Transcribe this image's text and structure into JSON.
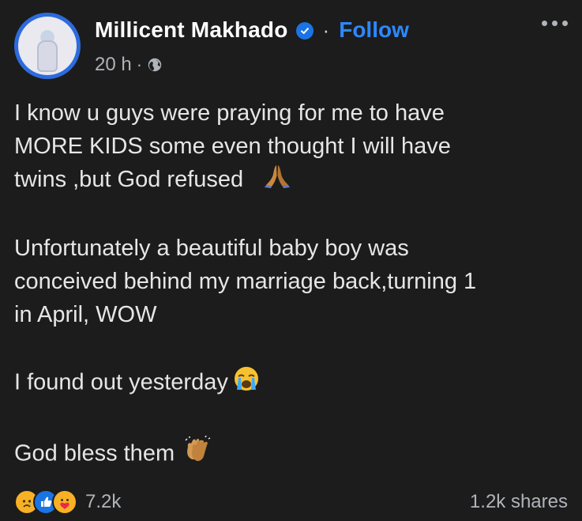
{
  "post": {
    "author": "Millicent Makhado",
    "follow_label": "Follow",
    "separator": "·",
    "time": "20 h",
    "lines_p1": [
      "I know u guys were praying for me to have",
      "MORE KIDS  some even thought I will have",
      "twins ,but God refused"
    ],
    "lines_p2": [
      "Unfortunately a beautiful baby boy was",
      "conceived behind my marriage back,turning 1",
      "in April, WOW"
    ],
    "line_p3": "I found out yesterday",
    "line_p4": "God bless them",
    "reaction_count": "7.2k",
    "shares": "1.2k shares"
  },
  "icons": {
    "avatar": "profile-photo",
    "verified": "verified-badge-icon",
    "globe": "globe-icon",
    "more": "more-options-icon",
    "emoji_p1": "praying-hands-emoji",
    "emoji_p3": "crying-face-emoji",
    "emoji_p4": "clapping-hands-emoji",
    "reactions": [
      "sad-reaction-icon",
      "like-reaction-icon",
      "care-reaction-icon"
    ]
  },
  "colors": {
    "background": "#1c1c1c",
    "follow": "#2d88ff",
    "verified": "#1b74e4",
    "muted": "#b0b3b8"
  }
}
